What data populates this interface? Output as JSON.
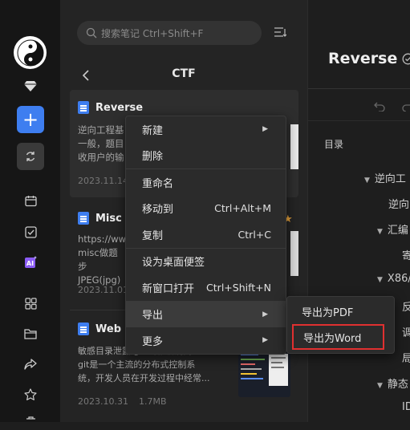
{
  "search": {
    "placeholder": "搜索笔记 Ctrl+Shift+F"
  },
  "folder": {
    "title": "CTF"
  },
  "notes": [
    {
      "title": "Reverse",
      "body": "逆向工程基\n一般，题目\n收用户的输",
      "date": "2023.11.14"
    },
    {
      "title": "Misc",
      "body": "https://ww\nmisc做题步\nJPEG(jpg)",
      "date": "2023.11.01"
    },
    {
      "title": "Web",
      "body": "敏感目录泄露 git泄露 漏洞简介:\ngit是一个主流的分布式控制系\n统，开发人员在开发过程中经常...",
      "date": "2023.10.31",
      "size": "1.7MB"
    }
  ],
  "editor": {
    "title": "Reverse",
    "toc_label": "目录",
    "toc": [
      "逆向工",
      "逆向",
      "汇编",
      "寄",
      "X86/",
      "反",
      "调",
      "局",
      "静态",
      "ID"
    ]
  },
  "context_menu": {
    "items": [
      {
        "label": "新建",
        "submenu": true
      },
      {
        "label": "删除"
      },
      {
        "label": "重命名"
      },
      {
        "label": "移动到",
        "shortcut": "Ctrl+Alt+M"
      },
      {
        "label": "复制",
        "shortcut": "Ctrl+C"
      },
      {
        "label": "设为桌面便签"
      },
      {
        "label": "新窗口打开",
        "shortcut": "Ctrl+Shift+N"
      },
      {
        "label": "导出",
        "submenu": true
      },
      {
        "label": "更多",
        "submenu": true
      }
    ]
  },
  "export_submenu": {
    "pdf": "导出为PDF",
    "word": "导出为Word"
  },
  "colors": {
    "accent": "#3e7ef0",
    "highlight_border": "#e03030"
  }
}
